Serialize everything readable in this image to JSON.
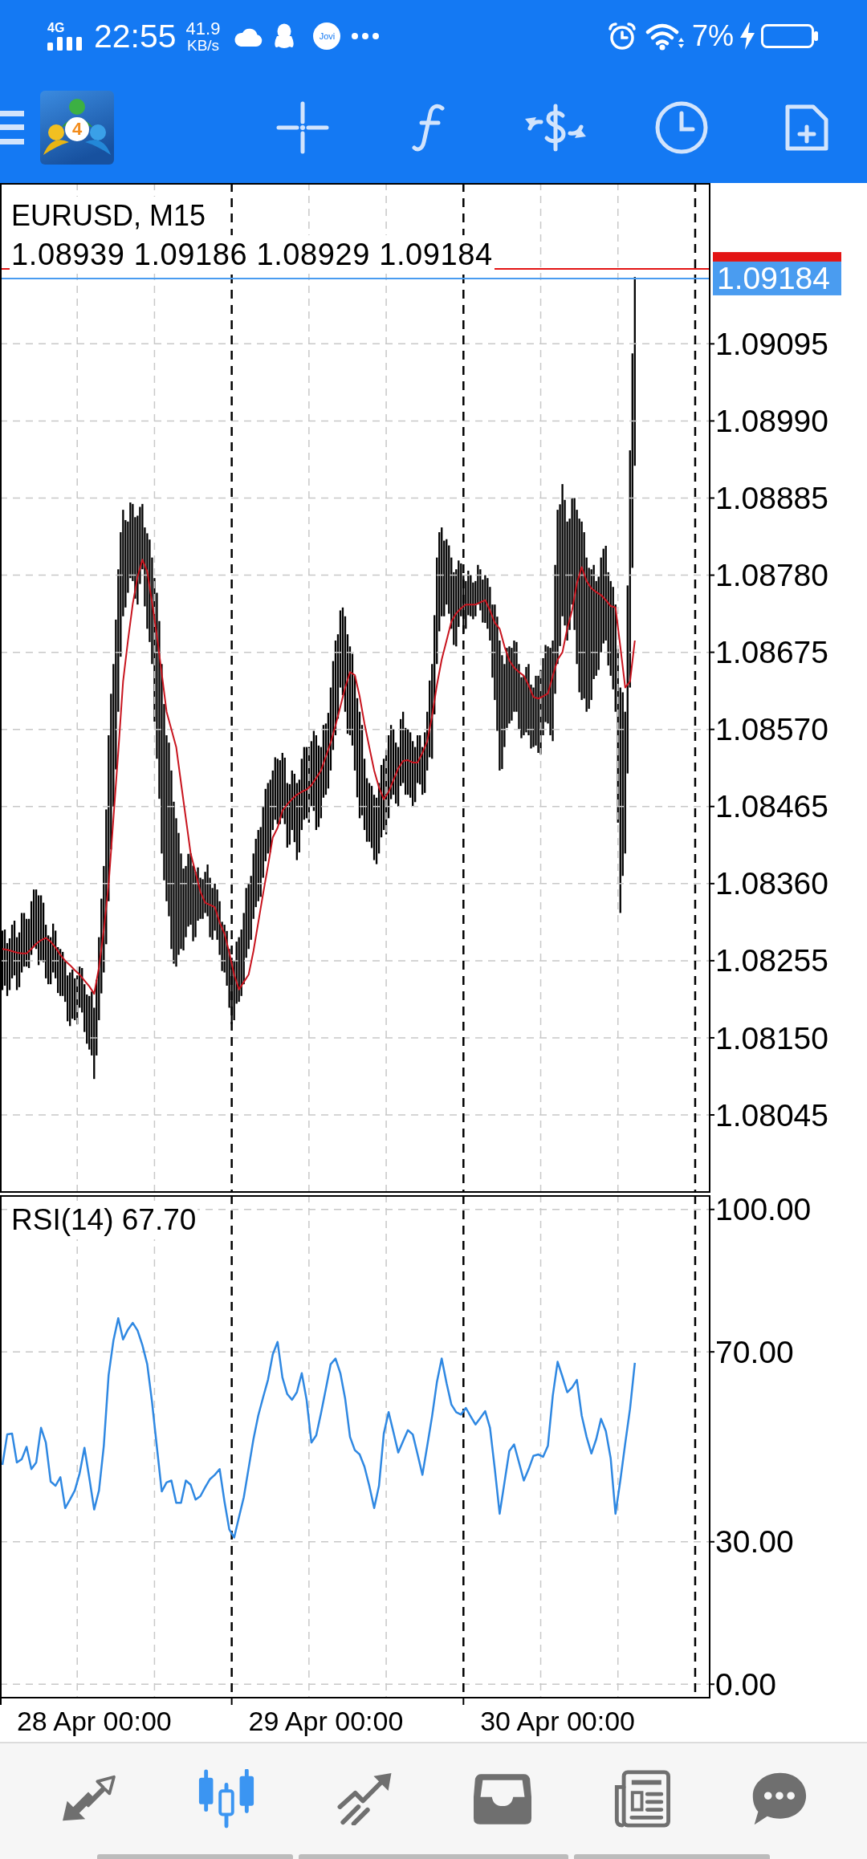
{
  "status_bar": {
    "network": "4G",
    "time": "22:55",
    "speed": "41.9",
    "speed_unit": "KB/s",
    "app_badge": "Jovi",
    "battery": "7%",
    "charging": true
  },
  "toolbar": {
    "logo_number": "4"
  },
  "price_chart": {
    "ohlc": "1.08939 1.09186 1.08929 1.09184",
    "chart_data": {
      "type": "line",
      "title": "EURUSD, M15",
      "grid": true,
      "ylim": [
        1.07939,
        1.09314
      ],
      "yticks": [
        {
          "value": 1.09095,
          "label": "1.09095"
        },
        {
          "value": 1.0899,
          "label": "1.08990"
        },
        {
          "value": 1.08885,
          "label": "1.08885"
        },
        {
          "value": 1.0878,
          "label": "1.08780"
        },
        {
          "value": 1.08675,
          "label": "1.08675"
        },
        {
          "value": 1.0857,
          "label": "1.08570"
        },
        {
          "value": 1.08465,
          "label": "1.08465"
        },
        {
          "value": 1.0836,
          "label": "1.08360"
        },
        {
          "value": 1.08255,
          "label": "1.08255"
        },
        {
          "value": 1.0815,
          "label": "1.08150"
        },
        {
          "value": 1.08045,
          "label": "1.08045"
        }
      ],
      "series": [
        {
          "color": "#c8141e",
          "values": [
            1.08271,
            1.0827,
            1.08268,
            1.08266,
            1.08265,
            1.08265,
            1.08271,
            1.08278,
            1.08283,
            1.08286,
            1.08281,
            1.08273,
            1.08263,
            1.08255,
            1.08249,
            1.08242,
            1.08236,
            1.08228,
            1.0822,
            1.0821,
            1.08246,
            1.08297,
            1.08359,
            1.08449,
            1.08539,
            1.08635,
            1.08691,
            1.08741,
            1.08778,
            1.08801,
            1.08785,
            1.08743,
            1.08698,
            1.08646,
            1.08594,
            1.0857,
            1.08546,
            1.08497,
            1.08449,
            1.08401,
            1.08375,
            1.08349,
            1.08334,
            1.08331,
            1.08328,
            1.08307,
            1.08292,
            1.08266,
            1.08236,
            1.08216,
            1.08226,
            1.08236,
            1.08268,
            1.08307,
            1.08346,
            1.08384,
            1.08423,
            1.08436,
            1.08459,
            1.08468,
            1.08475,
            1.08481,
            1.08485,
            1.08488,
            1.08494,
            1.08504,
            1.08514,
            1.08533,
            1.08552,
            1.08575,
            1.08601,
            1.08627,
            1.08648,
            1.08644,
            1.08615,
            1.08578,
            1.08546,
            1.08514,
            1.08491,
            1.08475,
            1.08485,
            1.08501,
            1.08517,
            1.08527,
            1.08528,
            1.08525,
            1.08525,
            1.08538,
            1.08554,
            1.08588,
            1.0863,
            1.08665,
            1.08691,
            1.08717,
            1.08728,
            1.08735,
            1.0874,
            1.0874,
            1.0874,
            1.08743,
            1.08746,
            1.08732,
            1.08715,
            1.08707,
            1.08683,
            1.08664,
            1.08654,
            1.08648,
            1.08643,
            1.0863,
            1.08614,
            1.08612,
            1.08615,
            1.08619,
            1.08643,
            1.08665,
            1.08675,
            1.08707,
            1.08732,
            1.08769,
            1.08791,
            1.08772,
            1.08762,
            1.08757,
            1.08753,
            1.08746,
            1.08738,
            1.08736,
            1.08683,
            1.08627,
            1.08635,
            1.08691,
            null,
            null,
            null,
            null,
            null,
            null,
            null,
            null,
            null,
            null,
            null,
            null,
            null,
            null,
            null
          ]
        }
      ],
      "ref_lines": [
        {
          "axis": "y",
          "value": 1.09197,
          "color": "#e31414"
        },
        {
          "axis": "y",
          "value": 1.09184,
          "label": "1.09184",
          "color": "#4a9cf0"
        }
      ]
    }
  },
  "indicator_chart": {
    "chart_data": {
      "type": "line",
      "title": "RSI(14) 67.70",
      "grid": true,
      "categories": [
        null,
        null,
        null,
        null,
        null,
        null,
        null,
        null,
        null,
        null,
        null,
        null,
        null,
        null,
        null,
        null,
        null,
        null,
        null,
        "28 Apr 00:00",
        null,
        null,
        null,
        null,
        null,
        null,
        null,
        null,
        null,
        null,
        null,
        null,
        null,
        null,
        null,
        null,
        null,
        null,
        null,
        null,
        null,
        null,
        null,
        null,
        null,
        null,
        null,
        null,
        null,
        null,
        null,
        null,
        null,
        null,
        null,
        null,
        null,
        null,
        null,
        null,
        null,
        null,
        null,
        null,
        null,
        null,
        null,
        "29 Apr 00:00",
        null,
        null,
        null,
        null,
        null,
        null,
        null,
        null,
        null,
        null,
        null,
        null,
        null,
        null,
        null,
        null,
        null,
        null,
        null,
        null,
        null,
        null,
        null,
        null,
        null,
        null,
        null,
        null,
        null,
        null,
        null,
        null,
        null,
        null,
        null,
        null,
        null,
        null,
        null,
        null,
        null,
        null,
        null,
        null,
        null,
        null,
        null,
        "30 Apr 00:00",
        null,
        null,
        null,
        null,
        null,
        null,
        null,
        null,
        null,
        null,
        null,
        null,
        null,
        null,
        null,
        null,
        null,
        null,
        null,
        null,
        null,
        null,
        null,
        null,
        null,
        null,
        null,
        null,
        null,
        null,
        null
      ],
      "ylim": [
        -3,
        103
      ],
      "yticks": [
        {
          "value": 100,
          "label": "100.00"
        },
        {
          "value": 70,
          "label": "70.00"
        },
        {
          "value": 30,
          "label": "30.00"
        },
        {
          "value": 0,
          "label": "0.00"
        }
      ],
      "series": [
        {
          "color": "#2f88e2",
          "values": [
            46.2,
            52.6,
            52.8,
            46.7,
            47.4,
            50.0,
            45.3,
            46.7,
            54.0,
            50.9,
            42.7,
            41.8,
            43.6,
            37.1,
            38.9,
            40.8,
            44.4,
            49.8,
            43.4,
            36.8,
            40.8,
            50.2,
            65.1,
            72.4,
            77.1,
            72.6,
            74.7,
            76.1,
            74.5,
            71.4,
            67.4,
            59.4,
            50.0,
            40.6,
            42.5,
            42.9,
            38.2,
            38.2,
            42.9,
            42.0,
            38.9,
            39.6,
            41.5,
            43.2,
            44.1,
            45.3,
            38.5,
            32.6,
            30.9,
            35.2,
            39.4,
            45.5,
            51.6,
            56.6,
            60.4,
            64.1,
            69.5,
            72.1,
            64.6,
            61.1,
            59.9,
            61.5,
            65.5,
            59.9,
            50.9,
            52.4,
            57.1,
            62.2,
            67.4,
            68.6,
            65.5,
            60.1,
            52.1,
            49.3,
            48.4,
            45.8,
            41.8,
            37.1,
            41.8,
            52.8,
            57.3,
            53.1,
            48.8,
            51.2,
            53.5,
            52.6,
            48.4,
            44.1,
            50.2,
            56.4,
            63.6,
            68.6,
            63.4,
            58.9,
            57.3,
            56.8,
            58.2,
            56.4,
            54.7,
            56.1,
            57.5,
            54.0,
            45.3,
            35.9,
            42.5,
            49.1,
            50.5,
            46.7,
            42.9,
            45.3,
            48.1,
            48.4,
            47.9,
            50.2,
            60.8,
            67.9,
            64.8,
            61.5,
            62.5,
            64.1,
            56.6,
            52.1,
            48.6,
            51.6,
            55.9,
            53.3,
            47.6,
            35.9,
            42.9,
            50.7,
            58.0,
            67.7,
            null,
            null,
            null,
            null,
            null,
            null,
            null,
            null,
            null,
            null,
            null,
            null,
            null,
            null,
            null
          ]
        }
      ]
    }
  },
  "bottom_nav": [
    {
      "selected": false
    },
    {
      "selected": true
    },
    {
      "selected": false
    },
    {
      "selected": false
    },
    {
      "selected": false
    },
    {
      "selected": false
    }
  ]
}
